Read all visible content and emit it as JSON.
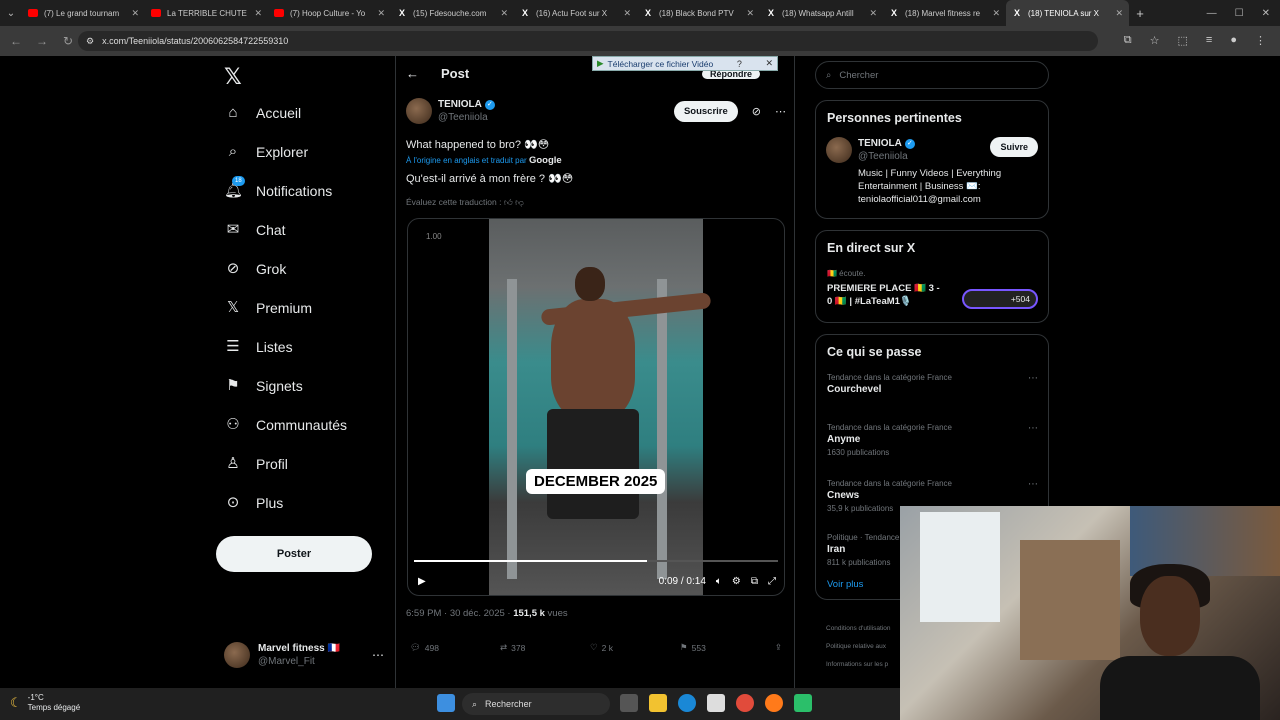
{
  "browser": {
    "tabs": [
      {
        "label": "(7) Le grand tournam",
        "icon": "youtube-icon"
      },
      {
        "label": "La TERRIBLE CHUTE",
        "icon": "youtube-icon"
      },
      {
        "label": "(7) Hoop Culture - Yo",
        "icon": "youtube-icon"
      },
      {
        "label": "(15) Fdesouche.com",
        "icon": "x-icon"
      },
      {
        "label": "(16) Actu Foot sur X",
        "icon": "x-icon"
      },
      {
        "label": "(18) Black Bond PTV",
        "icon": "x-icon"
      },
      {
        "label": "(18) Whatsapp Antill",
        "icon": "x-icon"
      },
      {
        "label": "(18) Marvel fitness re",
        "icon": "x-icon"
      },
      {
        "label": "(18) TENIOLA sur X",
        "icon": "x-icon",
        "active": true
      }
    ],
    "url": "x.com/Teeniiola/status/2006062584722559310"
  },
  "nav": {
    "items": [
      {
        "label": "Accueil",
        "icon": "home-icon"
      },
      {
        "label": "Explorer",
        "icon": "search-icon"
      },
      {
        "label": "Notifications",
        "icon": "bell-icon",
        "badge": "18"
      },
      {
        "label": "Chat",
        "icon": "mail-icon"
      },
      {
        "label": "Grok",
        "icon": "grok-icon"
      },
      {
        "label": "Premium",
        "icon": "x-logo-icon"
      },
      {
        "label": "Listes",
        "icon": "list-icon"
      },
      {
        "label": "Signets",
        "icon": "bookmark-icon"
      },
      {
        "label": "Communautés",
        "icon": "communities-icon"
      },
      {
        "label": "Profil",
        "icon": "person-icon"
      },
      {
        "label": "Plus",
        "icon": "more-circle-icon"
      }
    ],
    "post_button": "Poster",
    "account": {
      "name": "Marvel fitness 🇫🇷",
      "handle": "@Marvel_Fit"
    }
  },
  "post": {
    "header": "Post",
    "download_banner": "Télécharger ce fichier Vidéo",
    "download_help": "?",
    "reply_peek": "Répondre",
    "author": {
      "name": "TENIOLA",
      "handle": "@Teeniiola"
    },
    "subscribe": "Souscrire",
    "text": "What happened to bro? 👀😳",
    "translated_note": "À l'origine en anglais et traduit par",
    "translated_by": "Google",
    "translation": "Qu'est-il arrivé à mon frère ? 👀😳",
    "rate": "Évaluez cette traduction :",
    "video": {
      "speed": "1.00",
      "caption": "DECEMBER 2025",
      "time": "0:09 / 0:14",
      "progress": 0.64
    },
    "meta_time": "6:59 PM · 30 déc. 2025 · ",
    "views_count": "151,5 k",
    "views_label": " vues",
    "actions": {
      "replies": "498",
      "reposts": "378",
      "likes": "2 k",
      "bookmarks": "553"
    }
  },
  "right": {
    "search_placeholder": "Chercher",
    "related": {
      "title": "Personnes pertinentes",
      "name": "TENIOLA",
      "handle": "@Teeniiola",
      "follow": "Suivre",
      "bio": "Music | Funny Videos | Everything Entertainment | Business ✉️: teniolaofficial011@gmail.com"
    },
    "live": {
      "title": "En direct sur X",
      "listening": "🇬🇳 écoute.",
      "space_title": "PREMIERE PLACE 🇬🇳 3 - 0 🇬🇳 | #LaTeaM1🎙️",
      "count": "+504"
    },
    "trends": {
      "title": "Ce qui se passe",
      "items": [
        {
          "category": "Tendance dans la catégorie France",
          "topic": "Courchevel",
          "count": ""
        },
        {
          "category": "Tendance dans la catégorie France",
          "topic": "Anyme",
          "count": "1630 publications"
        },
        {
          "category": "Tendance dans la catégorie France",
          "topic": "Cnews",
          "count": "35,9 k publications"
        },
        {
          "category": "Politique · Tendance",
          "topic": "Iran",
          "count": "811 k publications"
        }
      ],
      "more": "Voir plus"
    },
    "footer": [
      "Conditions d'utilisation",
      "Politique relative aux",
      "Informations sur les p"
    ]
  },
  "taskbar": {
    "temp": "-1°C",
    "weather": "Temps dégagé",
    "search": "Rechercher"
  }
}
